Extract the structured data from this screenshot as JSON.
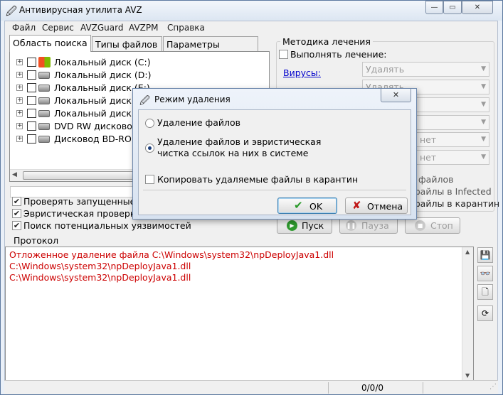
{
  "app": {
    "title": "Антивирусная утилита AVZ"
  },
  "menu": [
    "Файл",
    "Сервис",
    "AVZGuard",
    "AVZPM",
    "Справка"
  ],
  "tabs": [
    "Область поиска",
    "Типы файлов",
    "Параметры поиска"
  ],
  "tree": [
    "Локальный диск (C:)",
    "Локальный диск (D:)",
    "Локальный диск (E:)",
    "Локальный диск (F:)",
    "Локальный диск (G:)",
    "DVD RW дисковод (H:)",
    "Дисковод BD-ROM (I:)"
  ],
  "options": [
    "Проверять запущенные процессы",
    "Эвристическая проверка системы",
    "Поиск потенциальных уязвимостей"
  ],
  "treatment": {
    "group": "Методика лечения",
    "perform": "Выполнять лечение:",
    "viruses_link": "Вирусы:",
    "rows": [
      {
        "label": "Удалять"
      },
      {
        "label": "Удалять"
      },
      {
        "label": ""
      },
      {
        "label": ""
      },
      {
        "label": "нет"
      },
      {
        "label": "нет"
      }
    ],
    "copy_text_1": "файлов",
    "copy_text_2": "файлы в  Infected",
    "copy_text_3": "файлы в  карантин"
  },
  "actions": {
    "start": "Пуск",
    "pause": "Пауза",
    "stop": "Стоп"
  },
  "protocol": {
    "label": "Протокол",
    "lines": [
      "Отложенное удаление файла C:\\Windows\\system32\\npDeployJava1.dll",
      "C:\\Windows\\system32\\npDeployJava1.dll",
      "C:\\Windows\\system32\\npDeployJava1.dll"
    ]
  },
  "status": {
    "counter": "0/0/0"
  },
  "dialog": {
    "title": "Режим удаления",
    "option1": "Удаление файлов",
    "option2_line1": "Удаление файлов и эвристическая",
    "option2_line2": "чистка ссылок на них в системе",
    "checkbox": "Копировать удаляемые файлы в карантин",
    "ok": "OK",
    "cancel": "Отмена",
    "close": "✕"
  },
  "colors": {
    "accent": "#1b3d7a",
    "protocol_text": "#cc0000",
    "link": "#0000cc"
  }
}
